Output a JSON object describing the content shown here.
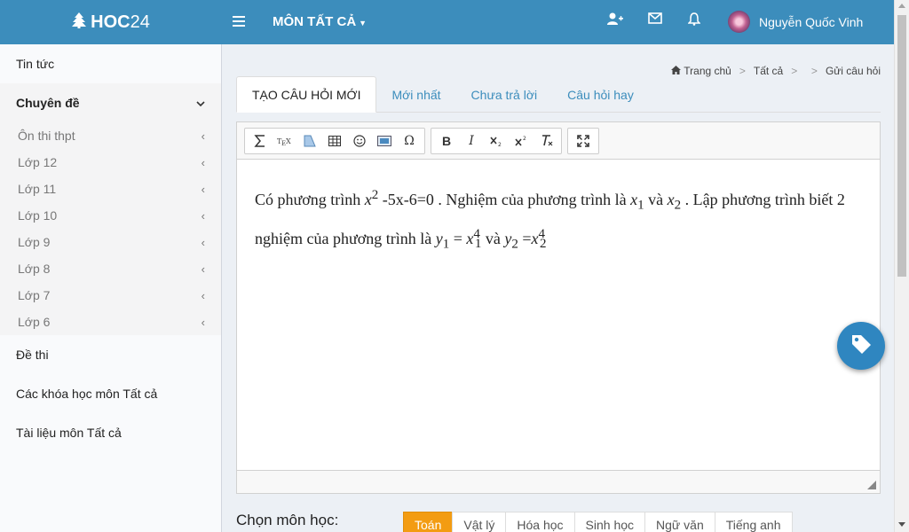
{
  "header": {
    "logo_text": "HOC",
    "logo_num": "24",
    "subject_menu": "MÔN TẤT CẢ",
    "user_name": "Nguyễn Quốc Vinh"
  },
  "sidebar": {
    "news": "Tin tức",
    "topics": {
      "label": "Chuyên đề",
      "items": [
        "Ôn thi thpt",
        "Lớp 12",
        "Lớp 11",
        "Lớp 10",
        "Lớp 9",
        "Lớp 8",
        "Lớp 7",
        "Lớp 6"
      ]
    },
    "exams": "Đề thi",
    "courses": "Các khóa học môn Tất cả",
    "documents": "Tài liệu môn Tất cả"
  },
  "breadcrumb": {
    "home": "Trang chủ",
    "all": "Tất cả",
    "current": "Gửi câu hỏi"
  },
  "tabs": [
    "TẠO CÂU HỎI MỚI",
    "Mới nhất",
    "Chưa trả lời",
    "Câu hỏi hay"
  ],
  "toolbar": {
    "omega": "Ω",
    "bold": "B",
    "italic": "I"
  },
  "question": {
    "t1": "Có phương trình ",
    "x_sq_base": "x",
    "x_sq_exp": "2",
    "t2": " -5x-6=0 . Nghiệm của phương trình là ",
    "x1_base": "x",
    "x1_sub": "1",
    "t3": " và ",
    "x2_base": "x",
    "x2_sub": "2",
    "t4": " . Lập phương trình biết 2 nghiệm của phương trình là ",
    "y1_base": "y",
    "y1_sub": "1",
    "t5": " = ",
    "x1p_base": "x",
    "x1p_sub": "1",
    "x1p_exp": "4",
    "t6": " và ",
    "y2_base": "y",
    "y2_sub": "2",
    "t7": " =",
    "x2p_base": "x",
    "x2p_sub": "2",
    "x2p_exp": "4"
  },
  "choose_subject": {
    "label": "Chọn môn học:",
    "subjects": [
      "Toán",
      "Vật lý",
      "Hóa học",
      "Sinh học",
      "Ngữ văn",
      "Tiếng anh"
    ]
  },
  "colors": {
    "primary": "#3c8dbc",
    "active_subject": "#f39c12"
  }
}
